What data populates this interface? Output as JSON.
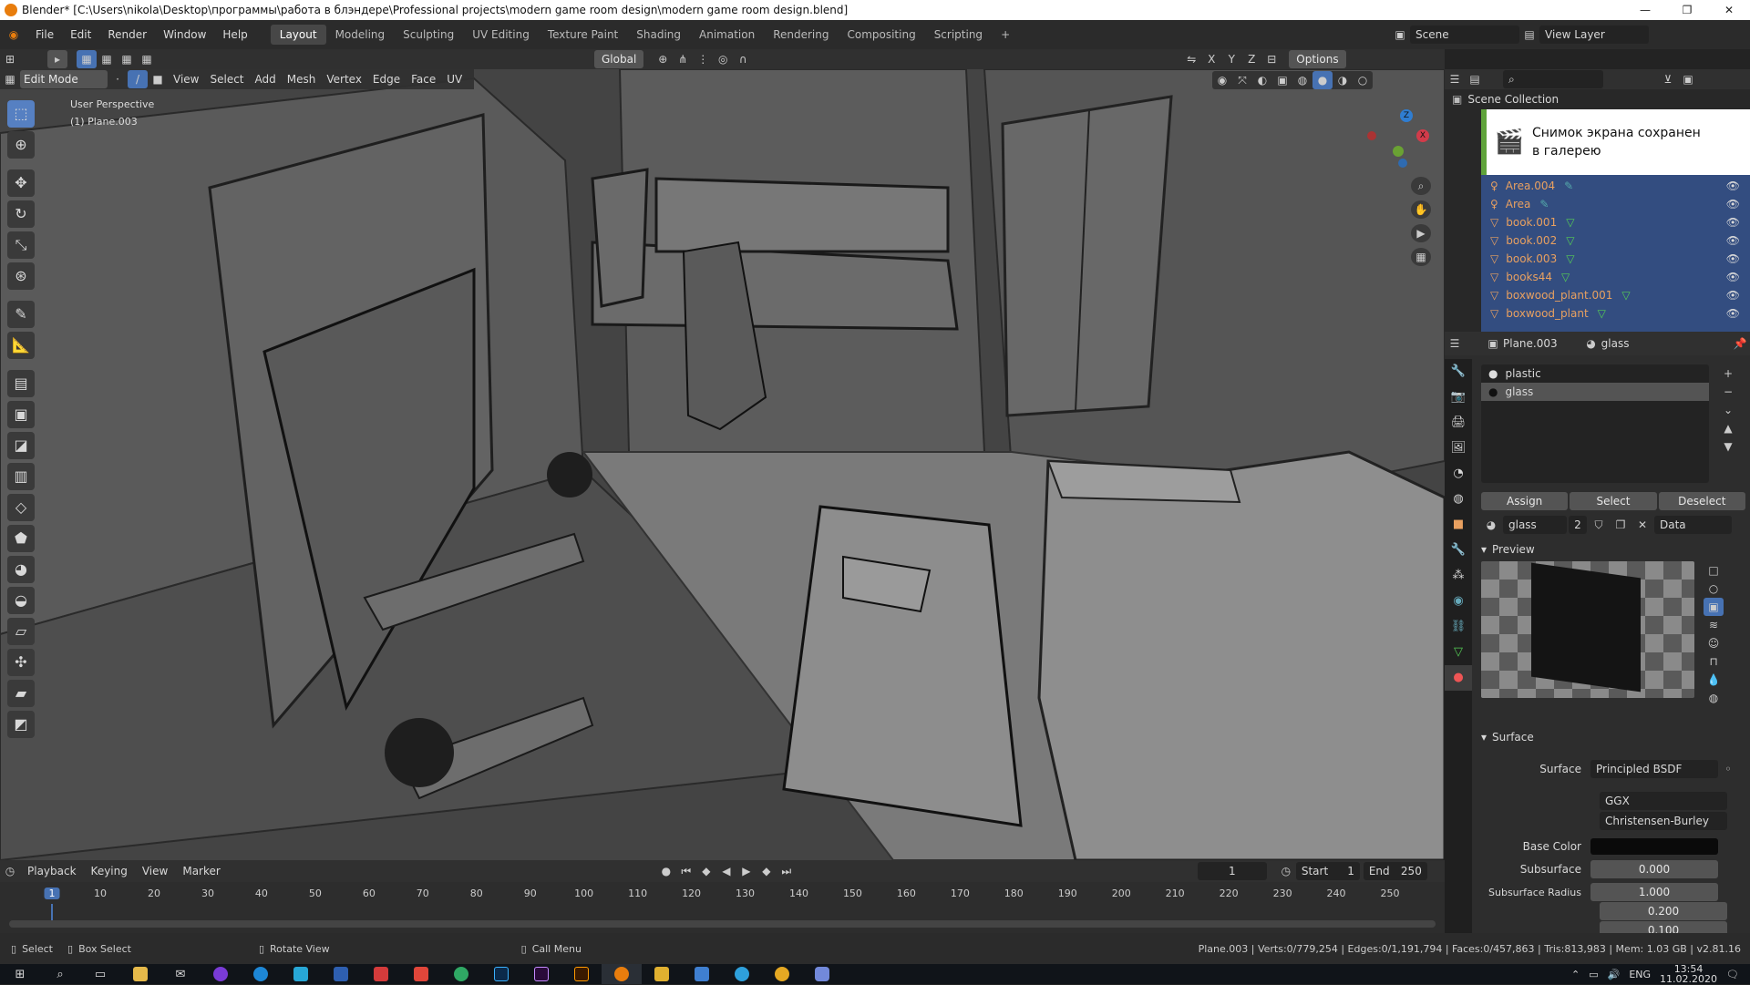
{
  "window": {
    "title": "Blender* [C:\\Users\\nikola\\Desktop\\программы\\работа в блэндере\\Professional projects\\modern game room design\\modern game room design.blend]"
  },
  "menu": {
    "items": [
      "File",
      "Edit",
      "Render",
      "Window",
      "Help"
    ]
  },
  "workspaces": [
    "Layout",
    "Modeling",
    "Sculpting",
    "UV Editing",
    "Texture Paint",
    "Shading",
    "Animation",
    "Rendering",
    "Compositing",
    "Scripting",
    "+"
  ],
  "scene": {
    "label": "Scene",
    "view_layer": "View Layer"
  },
  "viewport": {
    "orientation": "Global",
    "options": "Options",
    "axes": [
      "X",
      "Y",
      "Z"
    ],
    "mode": "Edit Mode",
    "menus": [
      "View",
      "Select",
      "Add",
      "Mesh",
      "Vertex",
      "Edge",
      "Face",
      "UV"
    ],
    "overlay_title": "User Perspective",
    "overlay_object": "(1) Plane.003"
  },
  "outliner": {
    "root": "Scene Collection",
    "items": [
      "Area.004",
      "Area",
      "book.001",
      "book.002",
      "book.003",
      "books44",
      "boxwood_plant.001",
      "boxwood_plant"
    ]
  },
  "toast": {
    "line1": "Снимок экрана сохранен",
    "line2": "в галерею"
  },
  "properties": {
    "object": "Plane.003",
    "material": "glass",
    "slots": [
      "plastic",
      "glass"
    ],
    "buttons": {
      "assign": "Assign",
      "select": "Select",
      "deselect": "Deselect"
    },
    "mat_name": "glass",
    "users": "2",
    "link": "Data",
    "preview": "Preview",
    "surface_panel": "Surface",
    "surface_label": "Surface",
    "surface_value": "Principled BSDF",
    "distribution": "GGX",
    "sss_method": "Christensen-Burley",
    "base_color": "Base Color",
    "subsurface": "Subsurface",
    "subsurface_value": "0.000",
    "subsurface_radius": "Subsurface Radius",
    "radius_values": [
      "1.000",
      "0.200",
      "0.100"
    ]
  },
  "timeline": {
    "menus": [
      "Playback",
      "Keying",
      "View",
      "Marker"
    ],
    "current": "1",
    "start_label": "Start",
    "start": "1",
    "end_label": "End",
    "end": "250",
    "ticks": [
      "1",
      "10",
      "20",
      "30",
      "40",
      "50",
      "60",
      "70",
      "80",
      "90",
      "100",
      "110",
      "120",
      "130",
      "140",
      "150",
      "160",
      "170",
      "180",
      "190",
      "200",
      "210",
      "220",
      "230",
      "240",
      "250"
    ]
  },
  "status": {
    "select": "Select",
    "box_select": "Box Select",
    "rotate": "Rotate View",
    "call_menu": "Call Menu",
    "stats": "Plane.003 | Verts:0/779,254 | Edges:0/1,191,794 | Faces:0/457,863 | Tris:813,983 | Mem: 1.03 GB | v2.81.16"
  },
  "taskbar": {
    "lang": "ENG",
    "time": "13:54",
    "date": "11.02.2020"
  },
  "colors": {
    "accent": "#4772b3",
    "blender_orange": "#e87d0d",
    "outliner_select": "#334d80"
  }
}
